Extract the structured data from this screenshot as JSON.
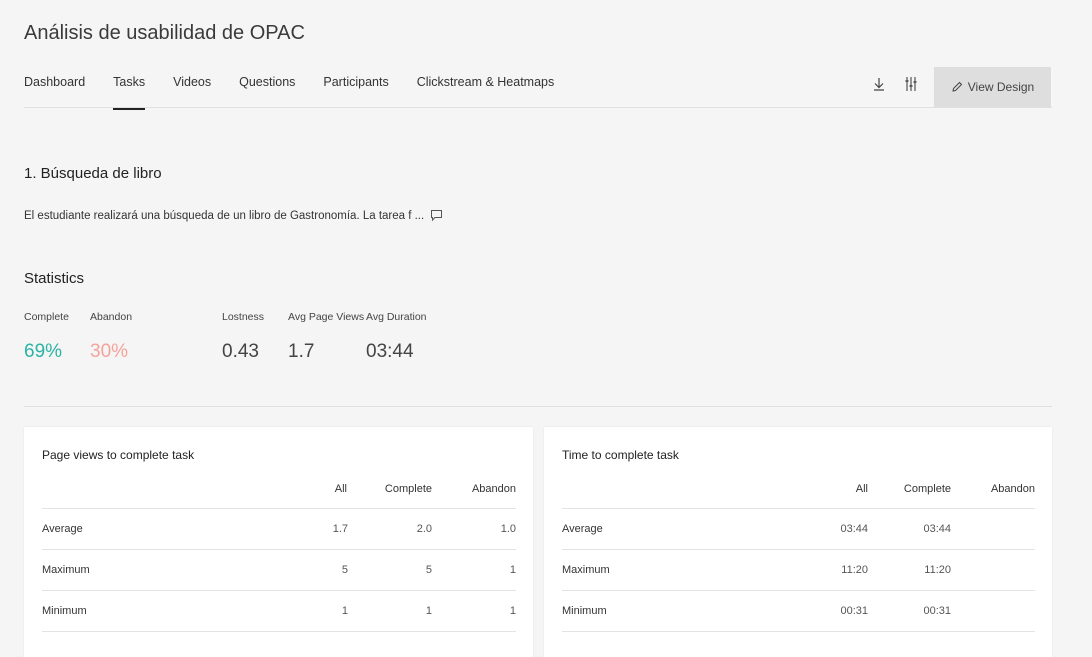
{
  "app": {
    "title": "Análisis de usabilidad de OPAC"
  },
  "nav": {
    "tabs": [
      "Dashboard",
      "Tasks",
      "Videos",
      "Questions",
      "Participants",
      "Clickstream & Heatmaps"
    ],
    "active": "Tasks"
  },
  "toolbar": {
    "view_design_label": "View Design",
    "download_icon": "download-icon",
    "filter_icon": "sliders-icon",
    "edit_icon": "pencil-icon"
  },
  "task": {
    "title": "1. Búsqueda de libro",
    "description": "El estudiante realizará una búsqueda de un libro de Gastronomía. La tarea f ...",
    "comment_icon": "comment-icon"
  },
  "statistics": {
    "title": "Statistics",
    "complete": {
      "label": "Complete",
      "value": "69%"
    },
    "abandon": {
      "label": "Abandon",
      "value": "30%"
    },
    "lostness": {
      "label": "Lostness",
      "value": "0.43"
    },
    "avg_page_views": {
      "label": "Avg Page Views",
      "value": "1.7"
    },
    "avg_duration": {
      "label": "Avg Duration",
      "value": "03:44"
    }
  },
  "page_views_card": {
    "title": "Page views to complete task",
    "headers": [
      "All",
      "Complete",
      "Abandon"
    ],
    "rows": [
      {
        "label": "Average",
        "all": "1.7",
        "complete": "2.0",
        "abandon": "1.0"
      },
      {
        "label": "Maximum",
        "all": "5",
        "complete": "5",
        "abandon": "1"
      },
      {
        "label": "Minimum",
        "all": "1",
        "complete": "1",
        "abandon": "1"
      }
    ]
  },
  "time_card": {
    "title": "Time to complete task",
    "headers": [
      "All",
      "Complete",
      "Abandon"
    ],
    "rows": [
      {
        "label": "Average",
        "all": "03:44",
        "complete": "03:44",
        "abandon": ""
      },
      {
        "label": "Maximum",
        "all": "11:20",
        "complete": "11:20",
        "abandon": ""
      },
      {
        "label": "Minimum",
        "all": "00:31",
        "complete": "00:31",
        "abandon": ""
      }
    ]
  },
  "colors": {
    "complete": "#2bb3a4",
    "abandon": "#f4a39b"
  }
}
